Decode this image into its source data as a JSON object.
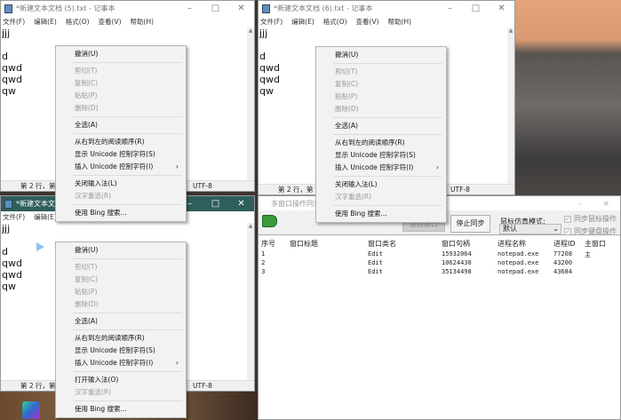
{
  "windows": [
    {
      "title": "*新建文本文档 (5).txt - 记事本",
      "lines": [
        "jjj",
        "",
        "d",
        "qwd",
        "qwd",
        "qw"
      ],
      "status": "第 2 行，第",
      "encoding": "UTF-8"
    },
    {
      "title": "*新建文本文档 (5).txt - 记事本",
      "lines": [
        "jjj",
        "",
        "d",
        "qwd",
        "qwd",
        "qw"
      ],
      "status": "第 2 行，第",
      "encoding": "UTF-8"
    },
    {
      "title": "*新建文本文档 (6).txt - 记事本",
      "lines": [
        "jjj",
        "",
        "d",
        "qwd",
        "qwd",
        "qw"
      ],
      "status": "第 2 行，第",
      "encoding": "UTF-8"
    }
  ],
  "menubar": [
    "文件(F)",
    "编辑(E)",
    "格式(O)",
    "查看(V)",
    "帮助(H)"
  ],
  "context_menus": [
    {
      "items": [
        {
          "label": "撤消(U)"
        },
        {
          "sep": true
        },
        {
          "label": "剪切(T)",
          "disabled": true
        },
        {
          "label": "复制(C)",
          "disabled": true
        },
        {
          "label": "粘贴(P)",
          "disabled": true
        },
        {
          "label": "删除(D)",
          "disabled": true
        },
        {
          "sep": true
        },
        {
          "label": "全选(A)"
        },
        {
          "sep": true
        },
        {
          "label": "从右到左的阅读顺序(R)"
        },
        {
          "label": "显示 Unicode 控制字符(S)"
        },
        {
          "label": "插入 Unicode 控制字符(I)",
          "submenu": true
        },
        {
          "sep": true
        },
        {
          "label": "关闭输入法(L)"
        },
        {
          "label": "汉字重选(R)",
          "disabled": true
        },
        {
          "sep": true
        },
        {
          "label": "使用 Bing 搜索..."
        }
      ]
    },
    {
      "items": [
        {
          "label": "撤消(U)"
        },
        {
          "sep": true
        },
        {
          "label": "剪切(T)",
          "disabled": true
        },
        {
          "label": "复制(C)",
          "disabled": true
        },
        {
          "label": "粘贴(P)",
          "disabled": true
        },
        {
          "label": "删除(D)",
          "disabled": true
        },
        {
          "sep": true
        },
        {
          "label": "全选(A)"
        },
        {
          "sep": true
        },
        {
          "label": "从右到左的阅读顺序(R)"
        },
        {
          "label": "显示 Unicode 控制字符(S)"
        },
        {
          "label": "插入 Unicode 控制字符(I)",
          "submenu": true
        },
        {
          "sep": true
        },
        {
          "label": "打开输入法(O)"
        },
        {
          "label": "汉字重选(R)",
          "disabled": true
        },
        {
          "sep": true
        },
        {
          "label": "使用 Bing 搜索..."
        }
      ]
    },
    {
      "items": [
        {
          "label": "撤消(U)"
        },
        {
          "sep": true
        },
        {
          "label": "剪切(T)",
          "disabled": true
        },
        {
          "label": "复制(C)",
          "disabled": true
        },
        {
          "label": "粘贴(P)",
          "disabled": true
        },
        {
          "label": "删除(D)",
          "disabled": true
        },
        {
          "sep": true
        },
        {
          "label": "全选(A)"
        },
        {
          "sep": true
        },
        {
          "label": "从右到左的阅读顺序(R)"
        },
        {
          "label": "显示 Unicode 控制字符(S)"
        },
        {
          "label": "插入 Unicode 控制字符(I)",
          "submenu": true
        },
        {
          "sep": true
        },
        {
          "label": "关闭输入法(L)"
        },
        {
          "label": "汉字重选(R)",
          "disabled": true
        },
        {
          "sep": true
        },
        {
          "label": "使用 Bing 搜索..."
        }
      ]
    }
  ],
  "sync_tool": {
    "title": "多窗口操作同步",
    "find_button": "查找窗口",
    "stop_button": "停止同步",
    "mode_label": "鼠标仿真模式:",
    "mode_value": "默认",
    "sync_mouse": "同步鼠标操作",
    "sync_keyboard": "同步键盘操作",
    "columns": [
      "序号",
      "窗口标题",
      "窗口类名",
      "窗口句柄",
      "进程名称",
      "进程ID",
      "主窗口"
    ],
    "rows": [
      [
        "1",
        "",
        "Edit",
        "15932064",
        "notepad.exe",
        "77208",
        "主"
      ],
      [
        "2",
        "",
        "Edit",
        "10624430",
        "notepad.exe",
        "43200",
        ""
      ],
      [
        "3",
        "",
        "Edit",
        "35134498",
        "notepad.exe",
        "43684",
        ""
      ]
    ]
  }
}
